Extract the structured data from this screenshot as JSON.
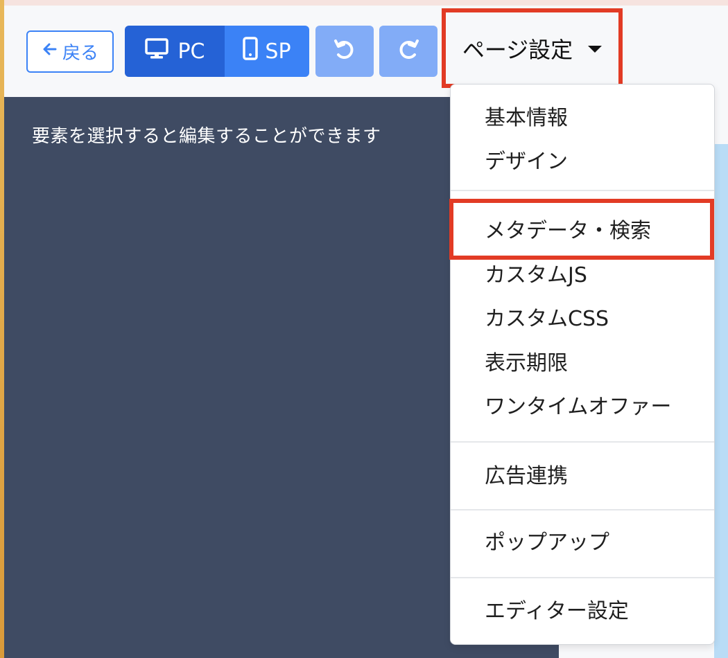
{
  "toolbar": {
    "back_label": "戻る",
    "pc_label": "PC",
    "sp_label": "SP",
    "page_settings_label": "ページ設定"
  },
  "canvas": {
    "message": "要素を選択すると編集することができます"
  },
  "dropdown": {
    "items": [
      {
        "label": "基本情報"
      },
      {
        "label": "デザイン"
      },
      {
        "label": "メタデータ・検索"
      },
      {
        "label": "カスタムJS"
      },
      {
        "label": "カスタムCSS"
      },
      {
        "label": "表示期限"
      },
      {
        "label": "ワンタイムオファー"
      },
      {
        "label": "広告連携"
      },
      {
        "label": "ポップアップ"
      },
      {
        "label": "エディター設定"
      }
    ]
  },
  "colors": {
    "primary": "#3b82f6",
    "primary_dark": "#2562d6",
    "disabled_blue": "#82acf7",
    "highlight_red": "#e23b25",
    "canvas_bg": "#3f4b63"
  },
  "icons": {
    "back": "arrow-left-icon",
    "pc": "monitor-icon",
    "sp": "smartphone-icon",
    "undo": "undo-icon",
    "redo": "redo-icon",
    "caret": "caret-down-icon"
  }
}
